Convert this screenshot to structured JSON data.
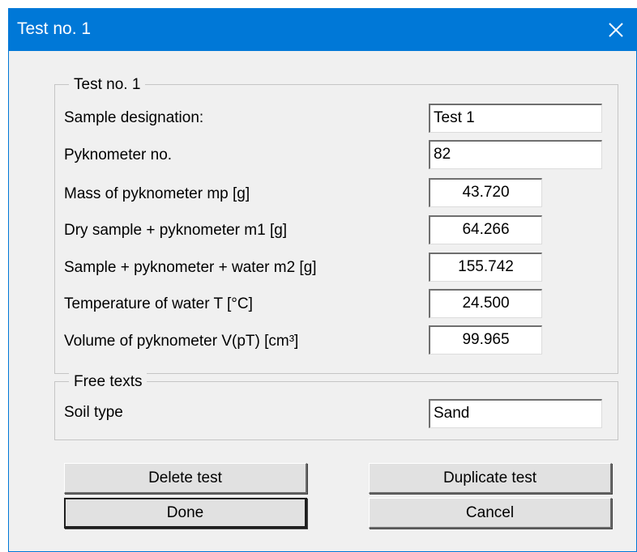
{
  "window": {
    "title": "Test no. 1"
  },
  "test_group": {
    "label": "Test no. 1",
    "fields": [
      {
        "label": "Sample designation:",
        "value": "Test 1"
      },
      {
        "label": "Pyknometer no.",
        "value": "82"
      },
      {
        "label": "Mass of pyknometer mp [g]",
        "value": "43.720"
      },
      {
        "label": "Dry sample + pyknometer m1 [g]",
        "value": "64.266"
      },
      {
        "label": "Sample + pyknometer + water m2 [g]",
        "value": "155.742"
      },
      {
        "label": "Temperature of water T [°C]",
        "value": "24.500"
      },
      {
        "label": "Volume of pyknometer V(pT) [cm³]",
        "value": "99.965"
      }
    ]
  },
  "free_texts_group": {
    "label": "Free texts",
    "fields": [
      {
        "label": "Soil type",
        "value": "Sand"
      }
    ]
  },
  "buttons": {
    "delete": "Delete test",
    "duplicate": "Duplicate test",
    "done": "Done",
    "cancel": "Cancel"
  },
  "icons": {
    "close": "close-icon"
  },
  "colors": {
    "titlebar": "#0078d7",
    "dialog_bg": "#f0f0f0"
  }
}
